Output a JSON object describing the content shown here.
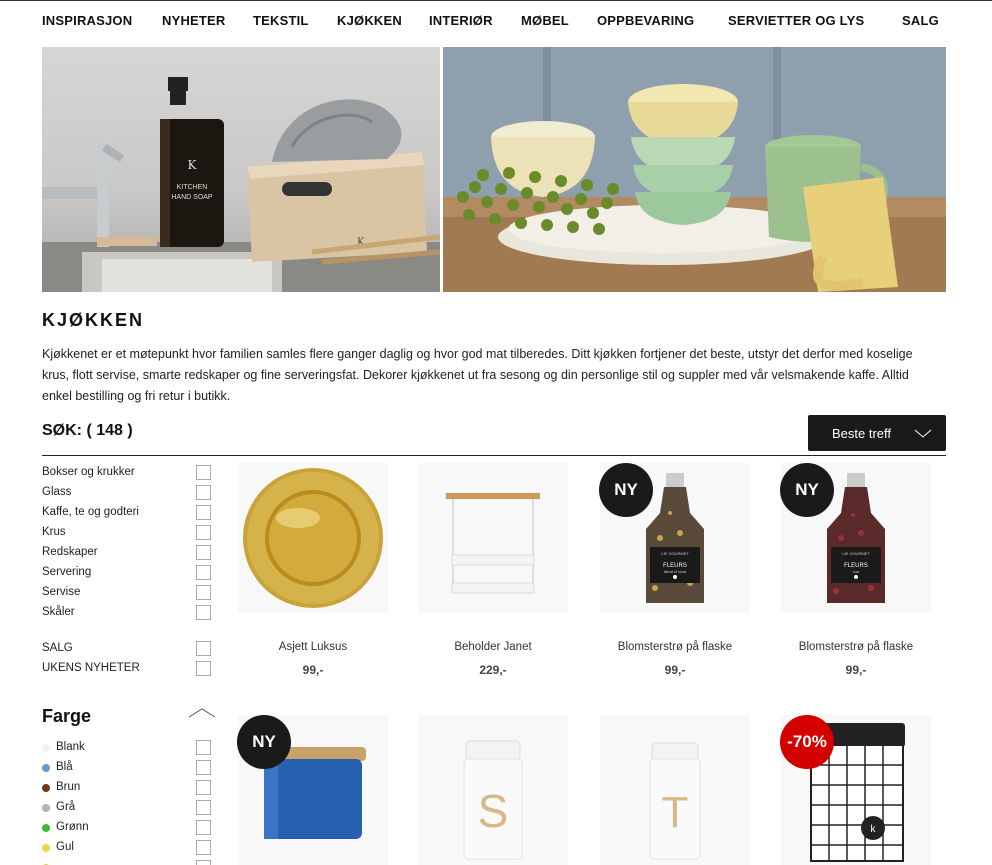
{
  "nav": [
    "INSPIRASJON",
    "NYHETER",
    "TEKSTIL",
    "KJØKKEN",
    "INTERIØR",
    "MØBEL",
    "OPPBEVARING",
    "SERVIETTER OG LYS",
    "SALG"
  ],
  "hero_left": {
    "soap_brand": "K",
    "soap_line1": "KITCHEN",
    "soap_line2": "HAND SOAP",
    "box_letter": "K"
  },
  "category": {
    "title": "KJØKKEN",
    "description": "Kjøkkenet er et møtepunkt hvor familien samles flere ganger daglig og hvor god mat tilberedes. Ditt kjøkken fortjener det beste, utstyr det derfor med koselige krus, flott servise, smarte redskaper og fine serveringsfat. Dekorer kjøkkenet ut fra sesong og din personlige stil og suppler med vår velsmakende kaffe. Alltid enkel bestilling og fri retur i butikk."
  },
  "search_count_label": "SØK: ( 148 )",
  "sort": {
    "label": "Beste treff"
  },
  "filters": [
    "Bokser og krukker",
    "Glass",
    "Kaffe, te og godteri",
    "Krus",
    "Redskaper",
    "Servering",
    "Servise",
    "Skåler"
  ],
  "extra_filters": [
    "SALG",
    "UKENS NYHETER"
  ],
  "colors_title": "Farge",
  "colors": [
    {
      "name": "Blank",
      "color": "#f1f1f1"
    },
    {
      "name": "Blå",
      "color": "#5aa0d8"
    },
    {
      "name": "Brun",
      "color": "#6b3a12"
    },
    {
      "name": "Grå",
      "color": "#b5b5b5"
    },
    {
      "name": "Grønn",
      "color": "#3cb83c"
    },
    {
      "name": "Gul",
      "color": "#e8d84a"
    }
  ],
  "products": [
    {
      "name": "Asjett Luksus",
      "price": "99,-",
      "badge": "",
      "image": "gold-plate"
    },
    {
      "name": "Beholder Janet",
      "price": "229,-",
      "badge": "",
      "image": "white-rack"
    },
    {
      "name": "Blomsterstrø på flaske",
      "price": "99,-",
      "badge": "NY",
      "badge_color": "#1a1a1a",
      "image": "flower-bottle-yellow",
      "bottle_brand": "LIE GOURMET",
      "bottle_label": "FLEURS",
      "bottle_sub": "bleuet et souci"
    },
    {
      "name": "Blomsterstrø på flaske",
      "price": "99,-",
      "badge": "NY",
      "badge_color": "#1a1a1a",
      "image": "flower-bottle-red",
      "bottle_brand": "LIE GOURMET",
      "bottle_label": "FLEURS",
      "bottle_sub": "rose"
    },
    {
      "name": "",
      "price": "",
      "badge": "NY",
      "badge_color": "#1a1a1a",
      "image": "blue-jar"
    },
    {
      "name": "",
      "price": "",
      "badge": "",
      "image": "jar-s",
      "letter": "S"
    },
    {
      "name": "",
      "price": "",
      "badge": "",
      "image": "jar-t",
      "letter": "T"
    },
    {
      "name": "",
      "price": "",
      "badge": "-70%",
      "badge_color": "#d40000",
      "image": "grid-tin",
      "logo": "k"
    }
  ]
}
